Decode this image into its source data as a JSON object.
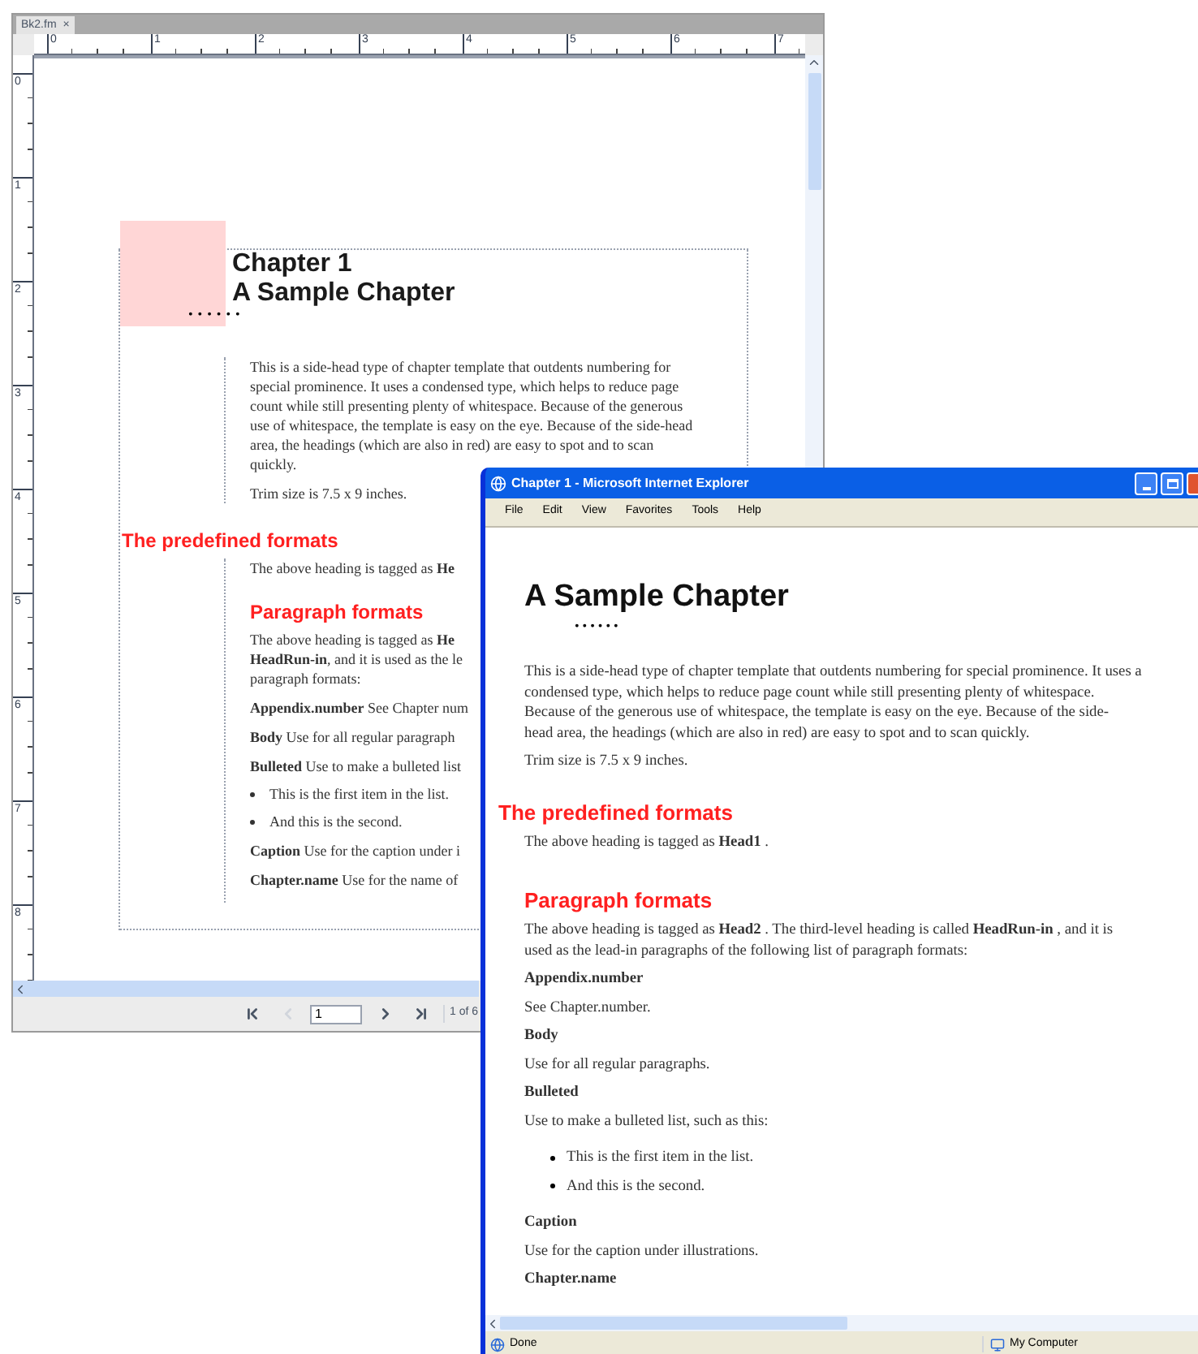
{
  "framemaker_window": {
    "tab": {
      "label": "Bk2.fm",
      "close": "×"
    },
    "top_ruler": [
      "0",
      "1",
      "2",
      "3",
      "4",
      "5",
      "6",
      "7"
    ],
    "left_ruler": [
      "0",
      "1",
      "2",
      "3",
      "4",
      "5",
      "6",
      "7",
      "8"
    ],
    "chapter_number": "Chapter 1",
    "chapter_title": "A Sample Chapter",
    "dots": "••••••",
    "intro": [
      "This is a side-head type of chapter template that outdents numbering for",
      "special prominence. It uses a condensed type, which helps to reduce page",
      "count while still presenting plenty of whitespace. Because of the generous",
      "use of whitespace, the template is easy on the eye. Because of the side-head",
      "area, the headings (which are also in red) are easy to spot and to scan",
      "quickly."
    ],
    "trim": "Trim size is 7.5 x 9 inches.",
    "side_heading": "The predefined formats",
    "body": [
      {
        "kind": "para",
        "lines": [
          "The above heading is tagged as **He**"
        ]
      },
      {
        "kind": "heading",
        "text": "Paragraph formats"
      },
      {
        "kind": "para",
        "lines": [
          "The above heading is tagged as **He**",
          "**HeadRun-in**, and it is used as the le",
          "paragraph formats:"
        ]
      },
      {
        "kind": "def",
        "text": "**Appendix.number**  See Chapter num"
      },
      {
        "kind": "def",
        "text": "**Body**  Use for all regular paragraph"
      },
      {
        "kind": "def",
        "text": "**Bulleted**  Use to make a bulleted list"
      },
      {
        "kind": "bullet",
        "text": "This is the first item in the list."
      },
      {
        "kind": "bullet",
        "text": "And this is the second."
      },
      {
        "kind": "def",
        "text": "**Caption**  Use for the caption under i"
      },
      {
        "kind": "def",
        "text": "**Chapter.name**  Use for the name of"
      }
    ],
    "navigation": {
      "buttons": [
        {
          "kind": "first",
          "disabled": false
        },
        {
          "kind": "prev",
          "disabled": true
        }
      ],
      "page_field": "1",
      "buttons_after": [
        {
          "kind": "next",
          "disabled": false
        },
        {
          "kind": "last",
          "disabled": false
        }
      ],
      "page_count": "1 of 6"
    }
  },
  "ie_window": {
    "title": "Chapter 1 - Microsoft Internet Explorer",
    "menu": [
      "File",
      "Edit",
      "View",
      "Favorites",
      "Tools",
      "Help"
    ],
    "content": [
      {
        "kind": "title",
        "text": "A Sample Chapter"
      },
      {
        "kind": "dots",
        "text": "••••••"
      },
      {
        "kind": "para",
        "lines": [
          "This is a side-head type of chapter template that outdents numbering for special prominence. It uses a",
          "condensed type, which helps to reduce page count while still presenting plenty of whitespace.",
          "Because of the generous use of whitespace, the template is easy on the eye. Because of the side-",
          "head area, the headings (which are also in red) are easy to spot and to scan quickly."
        ]
      },
      {
        "kind": "para",
        "lines": [
          "Trim size is 7.5 x 9 inches."
        ]
      },
      {
        "kind": "heading1",
        "text": "The predefined formats"
      },
      {
        "kind": "para",
        "lines": [
          "The above heading is tagged as **Head1** ."
        ]
      },
      {
        "kind": "heading2",
        "text": "Paragraph formats"
      },
      {
        "kind": "para",
        "lines": [
          "The above heading is tagged as **Head2** . The third-level heading is called **HeadRun-in** , and it is",
          "used as the lead-in paragraphs of the following list of paragraph formats:"
        ]
      },
      {
        "kind": "term",
        "text": "Appendix.number"
      },
      {
        "kind": "para",
        "lines": [
          "See Chapter.number."
        ]
      },
      {
        "kind": "term",
        "text": "Body"
      },
      {
        "kind": "para",
        "lines": [
          "Use for all regular paragraphs."
        ]
      },
      {
        "kind": "term",
        "text": "Bulleted"
      },
      {
        "kind": "para",
        "lines": [
          "Use to make a bulleted list, such as this:"
        ]
      },
      {
        "kind": "bullets",
        "items": [
          "This is the first item in the list.",
          "And this is the second."
        ]
      },
      {
        "kind": "term",
        "text": "Caption"
      },
      {
        "kind": "para",
        "lines": [
          "Use for the caption under illustrations."
        ]
      },
      {
        "kind": "term",
        "text": "Chapter.name"
      }
    ],
    "status": {
      "text": "Done",
      "zone": "My Computer"
    }
  }
}
